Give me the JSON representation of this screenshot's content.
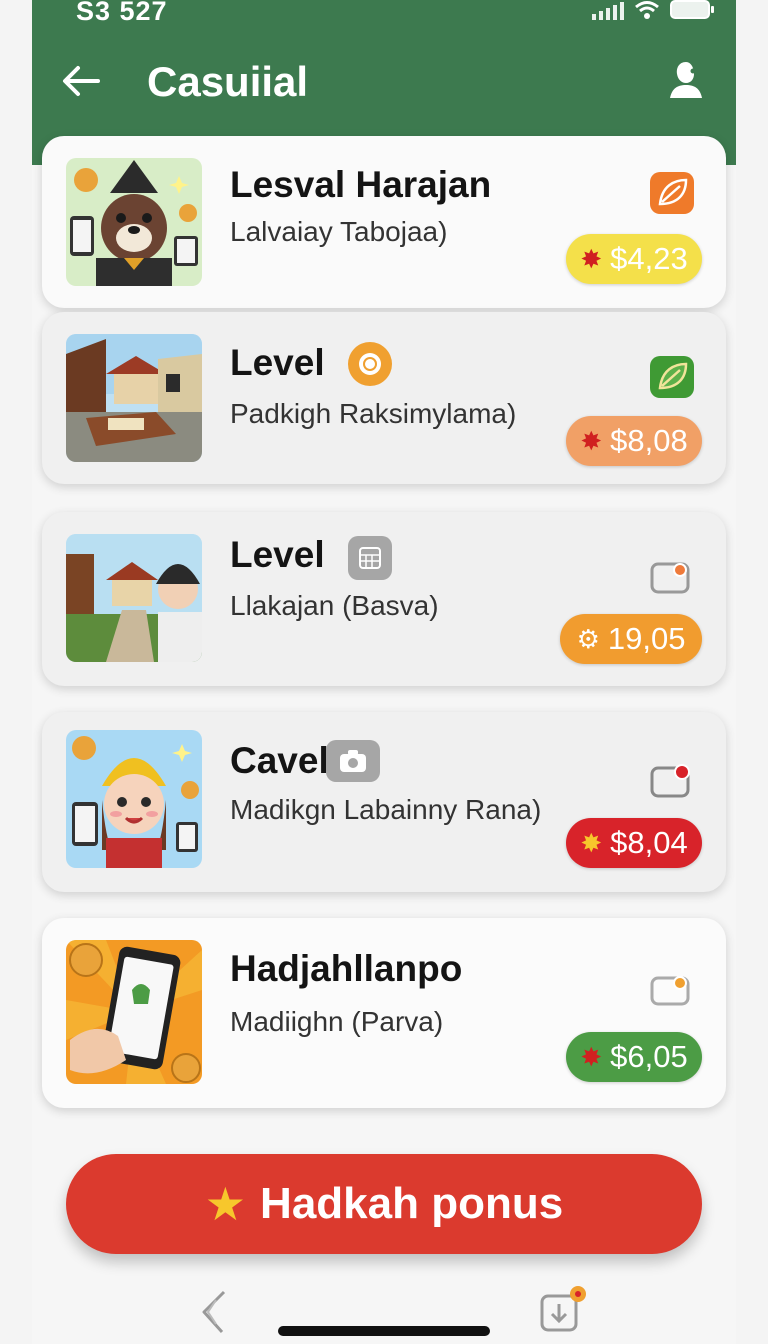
{
  "status_bar": {
    "time": "S3 527"
  },
  "header": {
    "title": "Casuiial"
  },
  "cards": [
    {
      "title": "Lesval Harajan",
      "subtitle": "Lalvaiay Tabojaa)",
      "price": "$4,23",
      "price_color": "#f4e04a",
      "price_text_color": "#ffffff",
      "corner_icon": "leaf-icon",
      "corner_color": "#ef7a2a",
      "title_badge": null
    },
    {
      "title": "Level",
      "subtitle": "Padkigh Raksimylama)",
      "price": "$8,08",
      "price_color": "#f1a066",
      "price_text_color": "#ffffff",
      "corner_icon": "leaf-icon",
      "corner_color": "#3f9a34",
      "title_badge": "coin-badge-icon"
    },
    {
      "title": "Level",
      "subtitle": "Llakajan (Basva)",
      "price": "19,05",
      "price_color": "#f19c2f",
      "price_text_color": "#ffffff",
      "corner_icon": "toggle-icon",
      "corner_color": "#999999",
      "title_badge": "calendar-badge-icon"
    },
    {
      "title": "Cavel",
      "subtitle": "Madikgn Labainny Rana)",
      "price": "$8,04",
      "price_color": "#d8232a",
      "price_text_color": "#ffffff",
      "corner_icon": "toggle-notify-icon",
      "corner_color": "#888888",
      "title_badge": "camera-badge-icon"
    },
    {
      "title": "Hadjahllanpo",
      "subtitle": "Madiighn (Parva)",
      "price": "$6,05",
      "price_color": "#4c9c45",
      "price_text_color": "#ffffff",
      "corner_icon": "toggle-icon",
      "corner_color": "#aaaaaa",
      "title_badge": null
    }
  ],
  "cta": {
    "label": "Hadkah ponus",
    "icon": "star-icon"
  },
  "colors": {
    "header_green": "#3d7a4f",
    "cta_red": "#db3a2e"
  }
}
